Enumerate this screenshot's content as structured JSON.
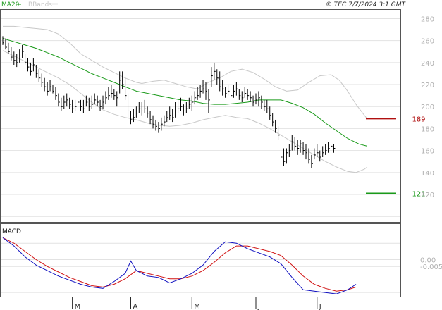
{
  "header": {
    "ma_label": "MA20",
    "bb_label": "BBands",
    "stamp": "© TEC 7/7/2024 3:1 GMT"
  },
  "colors": {
    "ma": "#1a9a1a",
    "bbands": "#c8c8c8",
    "bars": "#000000",
    "macd": "#1010c0",
    "signal": "#d01010",
    "resistance": "#b01010",
    "support": "#1a9a1a",
    "grid": "#e2e2e2"
  },
  "chart_data": [
    {
      "type": "ohlc",
      "price_ticks": [
        "280",
        "260",
        "240",
        "220",
        "200",
        "180",
        "160",
        "140",
        "120"
      ],
      "ylim": [
        95,
        288
      ],
      "x_month_labels": [
        {
          "label": "M",
          "index": 25
        },
        {
          "label": "A",
          "index": 46
        },
        {
          "label": "M",
          "index": 68
        },
        {
          "label": "J",
          "index": 91
        },
        {
          "label": "J",
          "index": 113
        }
      ],
      "bars": [
        [
          256,
          264,
          258
        ],
        [
          252,
          262,
          254
        ],
        [
          248,
          258,
          250
        ],
        [
          242,
          254,
          245
        ],
        [
          238,
          250,
          242
        ],
        [
          236,
          248,
          240
        ],
        [
          240,
          252,
          246
        ],
        [
          244,
          256,
          250
        ],
        [
          238,
          248,
          240
        ],
        [
          232,
          244,
          236
        ],
        [
          228,
          240,
          232
        ],
        [
          232,
          244,
          238
        ],
        [
          226,
          238,
          230
        ],
        [
          222,
          234,
          226
        ],
        [
          218,
          230,
          222
        ],
        [
          214,
          226,
          218
        ],
        [
          210,
          222,
          214
        ],
        [
          214,
          224,
          218
        ],
        [
          212,
          220,
          214
        ],
        [
          206,
          218,
          210
        ],
        [
          200,
          212,
          204
        ],
        [
          196,
          208,
          200
        ],
        [
          198,
          210,
          204
        ],
        [
          200,
          212,
          206
        ],
        [
          198,
          208,
          202
        ],
        [
          194,
          206,
          198
        ],
        [
          196,
          206,
          200
        ],
        [
          198,
          210,
          204
        ],
        [
          196,
          206,
          200
        ],
        [
          194,
          206,
          198
        ],
        [
          200,
          210,
          204
        ],
        [
          196,
          208,
          200
        ],
        [
          198,
          210,
          202
        ],
        [
          202,
          212,
          206
        ],
        [
          200,
          210,
          204
        ],
        [
          196,
          206,
          200
        ],
        [
          198,
          210,
          204
        ],
        [
          202,
          214,
          208
        ],
        [
          206,
          218,
          210
        ],
        [
          208,
          220,
          212
        ],
        [
          206,
          216,
          210
        ],
        [
          200,
          214,
          208
        ],
        [
          212,
          232,
          224
        ],
        [
          216,
          232,
          220
        ],
        [
          206,
          226,
          210
        ],
        [
          190,
          212,
          196
        ],
        [
          184,
          196,
          188
        ],
        [
          186,
          198,
          190
        ],
        [
          190,
          200,
          194
        ],
        [
          194,
          204,
          198
        ],
        [
          192,
          204,
          196
        ],
        [
          194,
          206,
          198
        ],
        [
          190,
          200,
          194
        ],
        [
          184,
          196,
          188
        ],
        [
          180,
          192,
          184
        ],
        [
          178,
          188,
          182
        ],
        [
          176,
          186,
          180
        ],
        [
          178,
          190,
          184
        ],
        [
          182,
          192,
          186
        ],
        [
          186,
          196,
          190
        ],
        [
          188,
          200,
          192
        ],
        [
          186,
          198,
          190
        ],
        [
          190,
          204,
          196
        ],
        [
          194,
          206,
          198
        ],
        [
          196,
          208,
          200
        ],
        [
          192,
          202,
          196
        ],
        [
          194,
          204,
          198
        ],
        [
          198,
          208,
          202
        ],
        [
          196,
          210,
          204
        ],
        [
          202,
          214,
          208
        ],
        [
          206,
          218,
          210
        ],
        [
          208,
          220,
          214
        ],
        [
          212,
          224,
          216
        ],
        [
          206,
          222,
          214
        ],
        [
          194,
          216,
          206
        ],
        [
          218,
          236,
          228
        ],
        [
          224,
          240,
          232
        ],
        [
          220,
          234,
          226
        ],
        [
          214,
          232,
          218
        ],
        [
          210,
          224,
          216
        ],
        [
          208,
          218,
          212
        ],
        [
          210,
          220,
          214
        ],
        [
          206,
          216,
          210
        ],
        [
          208,
          220,
          214
        ],
        [
          210,
          222,
          216
        ],
        [
          206,
          216,
          210
        ],
        [
          204,
          214,
          208
        ],
        [
          208,
          218,
          212
        ],
        [
          206,
          216,
          210
        ],
        [
          204,
          214,
          208
        ],
        [
          200,
          210,
          204
        ],
        [
          202,
          212,
          206
        ],
        [
          200,
          214,
          208
        ],
        [
          198,
          210,
          204
        ],
        [
          196,
          206,
          200
        ],
        [
          194,
          206,
          198
        ],
        [
          188,
          200,
          192
        ],
        [
          182,
          194,
          186
        ],
        [
          176,
          188,
          180
        ],
        [
          170,
          182,
          174
        ],
        [
          150,
          170,
          154
        ],
        [
          146,
          162,
          150
        ],
        [
          148,
          162,
          158
        ],
        [
          154,
          166,
          160
        ],
        [
          160,
          174,
          168
        ],
        [
          160,
          172,
          164
        ],
        [
          156,
          170,
          162
        ],
        [
          158,
          170,
          166
        ],
        [
          156,
          168,
          160
        ],
        [
          152,
          166,
          158
        ],
        [
          148,
          162,
          152
        ],
        [
          144,
          156,
          148
        ],
        [
          152,
          162,
          156
        ],
        [
          154,
          166,
          158
        ],
        [
          150,
          160,
          154
        ],
        [
          154,
          164,
          158
        ],
        [
          156,
          166,
          160
        ],
        [
          158,
          168,
          162
        ],
        [
          160,
          170,
          164
        ],
        [
          158,
          166,
          162
        ]
      ],
      "ma20": [
        [
          0,
          262
        ],
        [
          4,
          259
        ],
        [
          8,
          256
        ],
        [
          12,
          253
        ],
        [
          16,
          249
        ],
        [
          20,
          245
        ],
        [
          24,
          240
        ],
        [
          28,
          235
        ],
        [
          32,
          230
        ],
        [
          36,
          226
        ],
        [
          40,
          222
        ],
        [
          44,
          218
        ],
        [
          48,
          214
        ],
        [
          52,
          212
        ],
        [
          56,
          210
        ],
        [
          60,
          208
        ],
        [
          64,
          206
        ],
        [
          68,
          205
        ],
        [
          72,
          203
        ],
        [
          76,
          202
        ],
        [
          80,
          202
        ],
        [
          84,
          203
        ],
        [
          88,
          204
        ],
        [
          92,
          206
        ],
        [
          96,
          206
        ],
        [
          100,
          206
        ],
        [
          104,
          203
        ],
        [
          108,
          199
        ],
        [
          112,
          193
        ],
        [
          116,
          185
        ],
        [
          120,
          178
        ],
        [
          124,
          171
        ],
        [
          128,
          166
        ],
        [
          131,
          164
        ]
      ],
      "bb_upper": [
        [
          0,
          273
        ],
        [
          4,
          273
        ],
        [
          8,
          272
        ],
        [
          12,
          271
        ],
        [
          16,
          270
        ],
        [
          20,
          266
        ],
        [
          24,
          258
        ],
        [
          28,
          248
        ],
        [
          32,
          242
        ],
        [
          36,
          236
        ],
        [
          40,
          231
        ],
        [
          44,
          226
        ],
        [
          48,
          222
        ],
        [
          50,
          221
        ],
        [
          54,
          223
        ],
        [
          58,
          224
        ],
        [
          62,
          221
        ],
        [
          66,
          218
        ],
        [
          70,
          216
        ],
        [
          74,
          222
        ],
        [
          78,
          226
        ],
        [
          82,
          232
        ],
        [
          86,
          234
        ],
        [
          90,
          231
        ],
        [
          94,
          225
        ],
        [
          98,
          218
        ],
        [
          102,
          214
        ],
        [
          106,
          215
        ],
        [
          110,
          222
        ],
        [
          114,
          228
        ],
        [
          118,
          229
        ],
        [
          121,
          224
        ],
        [
          124,
          214
        ],
        [
          127,
          202
        ],
        [
          130,
          192
        ],
        [
          131,
          189
        ]
      ],
      "bb_lower": [
        [
          0,
          251
        ],
        [
          4,
          246
        ],
        [
          8,
          241
        ],
        [
          12,
          236
        ],
        [
          16,
          231
        ],
        [
          20,
          226
        ],
        [
          24,
          220
        ],
        [
          28,
          212
        ],
        [
          32,
          204
        ],
        [
          36,
          197
        ],
        [
          40,
          193
        ],
        [
          44,
          190
        ],
        [
          48,
          188
        ],
        [
          52,
          185
        ],
        [
          56,
          183
        ],
        [
          60,
          182
        ],
        [
          64,
          183
        ],
        [
          68,
          185
        ],
        [
          72,
          188
        ],
        [
          76,
          190
        ],
        [
          80,
          192
        ],
        [
          84,
          190
        ],
        [
          88,
          189
        ],
        [
          92,
          185
        ],
        [
          96,
          180
        ],
        [
          100,
          174
        ],
        [
          104,
          168
        ],
        [
          108,
          162
        ],
        [
          112,
          156
        ],
        [
          116,
          150
        ],
        [
          120,
          145
        ],
        [
          124,
          141
        ],
        [
          127,
          140
        ],
        [
          130,
          143
        ],
        [
          131,
          145
        ]
      ],
      "levels": [
        {
          "label": "189",
          "value": 189,
          "color": "resistance"
        },
        {
          "label": "121",
          "value": 121,
          "color": "support"
        }
      ]
    },
    {
      "type": "line",
      "title": "MACD",
      "ticks": [
        "0.00",
        "-0.005"
      ],
      "ylim": [
        -0.027,
        0.026
      ],
      "macd": [
        [
          0,
          0.016
        ],
        [
          4,
          0.01
        ],
        [
          8,
          0.002
        ],
        [
          12,
          -0.004
        ],
        [
          16,
          -0.008
        ],
        [
          20,
          -0.012
        ],
        [
          24,
          -0.015
        ],
        [
          28,
          -0.018
        ],
        [
          32,
          -0.02
        ],
        [
          36,
          -0.021
        ],
        [
          40,
          -0.016
        ],
        [
          44,
          -0.01
        ],
        [
          46,
          -0.001
        ],
        [
          48,
          -0.008
        ],
        [
          52,
          -0.012
        ],
        [
          56,
          -0.013
        ],
        [
          60,
          -0.017
        ],
        [
          64,
          -0.014
        ],
        [
          68,
          -0.01
        ],
        [
          72,
          -0.004
        ],
        [
          76,
          0.006
        ],
        [
          80,
          0.013
        ],
        [
          84,
          0.012
        ],
        [
          88,
          0.008
        ],
        [
          92,
          0.005
        ],
        [
          96,
          0.002
        ],
        [
          100,
          -0.003
        ],
        [
          104,
          -0.013
        ],
        [
          108,
          -0.022
        ],
        [
          112,
          -0.023
        ],
        [
          116,
          -0.024
        ],
        [
          120,
          -0.025
        ],
        [
          124,
          -0.022
        ],
        [
          127,
          -0.018
        ]
      ],
      "signal": [
        [
          0,
          0.016
        ],
        [
          4,
          0.012
        ],
        [
          8,
          0.006
        ],
        [
          12,
          0.0
        ],
        [
          16,
          -0.005
        ],
        [
          20,
          -0.009
        ],
        [
          24,
          -0.013
        ],
        [
          28,
          -0.016
        ],
        [
          32,
          -0.019
        ],
        [
          36,
          -0.02
        ],
        [
          40,
          -0.018
        ],
        [
          44,
          -0.014
        ],
        [
          48,
          -0.008
        ],
        [
          52,
          -0.01
        ],
        [
          56,
          -0.012
        ],
        [
          60,
          -0.014
        ],
        [
          64,
          -0.014
        ],
        [
          68,
          -0.012
        ],
        [
          72,
          -0.008
        ],
        [
          76,
          -0.002
        ],
        [
          80,
          0.005
        ],
        [
          84,
          0.01
        ],
        [
          88,
          0.01
        ],
        [
          92,
          0.008
        ],
        [
          96,
          0.006
        ],
        [
          100,
          0.003
        ],
        [
          104,
          -0.004
        ],
        [
          108,
          -0.012
        ],
        [
          112,
          -0.018
        ],
        [
          116,
          -0.021
        ],
        [
          120,
          -0.023
        ],
        [
          124,
          -0.022
        ],
        [
          127,
          -0.02
        ]
      ]
    }
  ]
}
